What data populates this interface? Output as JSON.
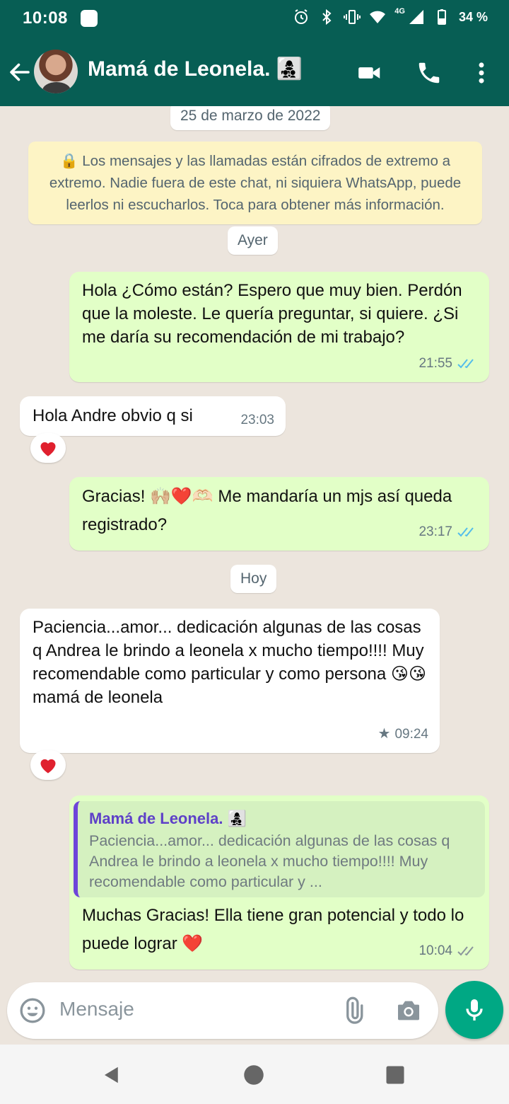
{
  "status_bar": {
    "time": "10:08",
    "network": "4G",
    "battery": "34 %"
  },
  "header": {
    "contact_name": "Mamá de Leonela. 👩‍👧‍👦",
    "back_icon": "arrow-left-icon",
    "video_icon": "video-call-icon",
    "call_icon": "phone-icon",
    "menu_icon": "more-vert-icon"
  },
  "chat": {
    "date_first": "25 de marzo de 2022",
    "encryption_notice": "🔒 Los mensajes y las llamadas están cifrados de extremo a extremo. Nadie fuera de este chat, ni siquiera WhatsApp, puede leerlos ni escucharlos. Toca para obtener más información.",
    "date_yesterday": "Ayer",
    "date_today": "Hoy",
    "messages": [
      {
        "text": "Hola ¿Cómo están? Espero que muy bien. Perdón que la moleste. Le quería preguntar, si quiere. ¿Si me daría su recomendación de mi trabajo?",
        "time": "21:55",
        "status": "read"
      },
      {
        "text": "Hola Andre obvio q si",
        "time": "23:03",
        "reaction": "❤️"
      },
      {
        "text": "Gracias! 🙌🏼❤️🫶🏻 Me mandaría un mjs así queda registrado?",
        "time": "23:17",
        "status": "read"
      },
      {
        "text": "Paciencia...amor... dedicación algunas de las cosas q Andrea le brindo a leonela x mucho tiempo!!!! Muy recomendable como particular y como persona 😘😘 mamá de leonela",
        "time": "09:24",
        "starred": true,
        "reaction": "❤️"
      },
      {
        "quote_name": "Mamá de Leonela. 👩‍👧‍👦",
        "quote_text": "Paciencia...amor... dedicación algunas de las cosas q Andrea le brindo a leonela x mucho tiempo!!!! Muy recomendable como particular y ...",
        "text": "Muchas Gracias! Ella tiene gran potencial y todo lo puede lograr ❤️",
        "time": "10:04",
        "status": "delivered"
      }
    ]
  },
  "composer": {
    "placeholder": "Mensaje"
  },
  "colors": {
    "header": "#075e54",
    "outgoing": "#e2ffc7",
    "incoming": "#ffffff",
    "read_ticks": "#53bdeb",
    "mic": "#00a884"
  }
}
